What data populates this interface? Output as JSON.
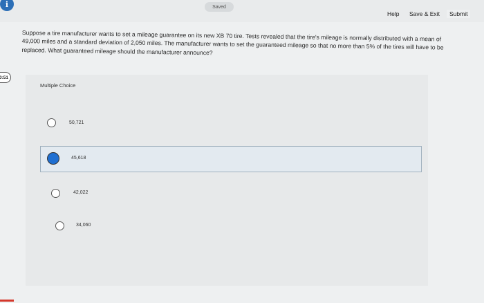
{
  "header": {
    "saved_label": "Saved",
    "help_label": "Help",
    "save_exit_label": "Save & Exit",
    "submit_label": "Submit"
  },
  "info_badge": "i",
  "timer": "0:51",
  "question": {
    "text": "Suppose a tire manufacturer wants to set a mileage guarantee on its new XB 70 tire. Tests revealed that the tire's mileage is normally distributed with a mean of 49,000 miles and a standard deviation of 2,050 miles. The manufacturer wants to set the guaranteed mileage so that no more than 5% of the tires will have to be replaced. What guaranteed mileage should the manufacturer announce?"
  },
  "multiple_choice": {
    "label": "Multiple Choice",
    "options": [
      {
        "text": "50,721",
        "selected": false
      },
      {
        "text": "45,618",
        "selected": true
      },
      {
        "text": "42,022",
        "selected": false
      },
      {
        "text": "34,060",
        "selected": false
      }
    ]
  },
  "colors": {
    "selected_fill": "#1f6fd1",
    "accent_blue": "#2c6fb7"
  }
}
